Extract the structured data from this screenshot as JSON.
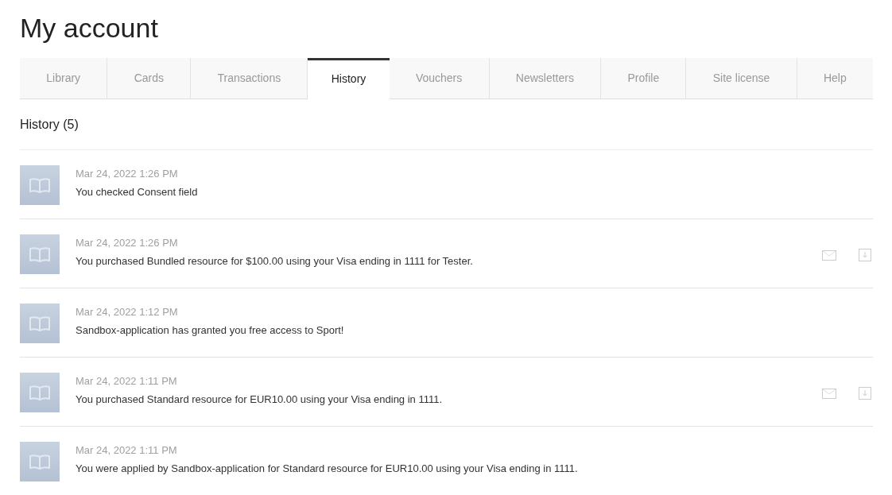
{
  "page_title": "My account",
  "tabs": [
    {
      "label": "Library",
      "selected": false
    },
    {
      "label": "Cards",
      "selected": false
    },
    {
      "label": "Transactions",
      "selected": false
    },
    {
      "label": "History",
      "selected": true
    },
    {
      "label": "Vouchers",
      "selected": false
    },
    {
      "label": "Newsletters",
      "selected": false
    },
    {
      "label": "Profile",
      "selected": false
    },
    {
      "label": "Site license",
      "selected": false
    },
    {
      "label": "Help",
      "selected": false
    }
  ],
  "section_heading": "History (5)",
  "history": [
    {
      "date": "Mar 24, 2022 1:26 PM",
      "text": "You checked Consent field",
      "receipt_actions": false
    },
    {
      "date": "Mar 24, 2022 1:26 PM",
      "text": "You purchased Bundled resource for $100.00 using your Visa ending in 1111 for Tester.",
      "receipt_actions": true
    },
    {
      "date": "Mar 24, 2022 1:12 PM",
      "text": "Sandbox-application has granted you free access to Sport!",
      "receipt_actions": false
    },
    {
      "date": "Mar 24, 2022 1:11 PM",
      "text": "You purchased Standard resource for EUR10.00 using your Visa ending in 1111.",
      "receipt_actions": true
    },
    {
      "date": "Mar 24, 2022 1:11 PM",
      "text": "You were applied by Sandbox-application for Standard resource for EUR10.00 using your Visa ending in 1111.",
      "receipt_actions": false
    }
  ]
}
